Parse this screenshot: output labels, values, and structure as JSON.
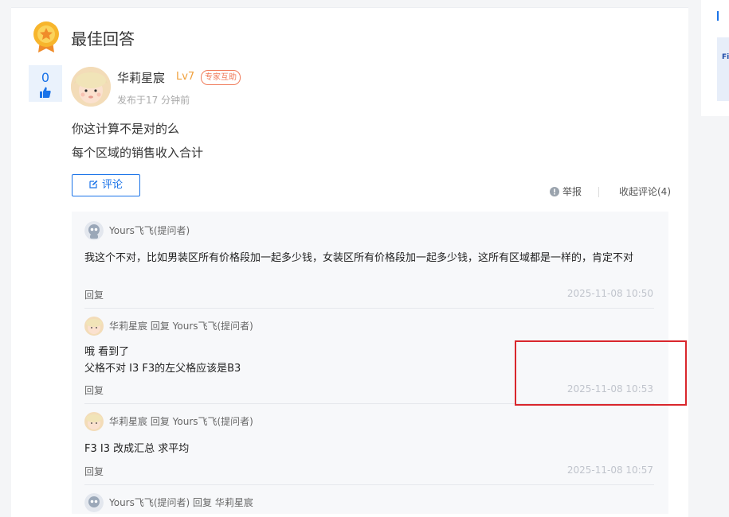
{
  "best_answer": {
    "title": "最佳回答",
    "vote_count": "0"
  },
  "author": {
    "name": "华莉星宸",
    "level": "Lv7",
    "tag": "专家互助",
    "posted": "发布于17 分钟前"
  },
  "answer_lines": [
    "你这计算不是对的么",
    "每个区域的销售收入合计"
  ],
  "actions": {
    "comment": "评论",
    "report": "举报",
    "collapse": "收起评论(4)"
  },
  "comments": [
    {
      "header": "Yours飞飞(提问者)",
      "lines": [
        "我这个不对，比如男装区所有价格段加一起多少钱，女装区所有价格段加一起多少钱，这所有区域都是一样的，肯定不对"
      ],
      "reply": "回复",
      "time": "2025-11-08 10:50"
    },
    {
      "header": "华莉星宸 回复 Yours飞飞(提问者)",
      "lines": [
        "哦 看到了",
        "父格不对 I3 F3的左父格应该是B3"
      ],
      "reply": "回复",
      "time": "2025-11-08 10:53"
    },
    {
      "header": "华莉星宸 回复 Yours飞飞(提问者)",
      "lines": [
        "F3 I3 改成汇总 求平均"
      ],
      "reply": "回复",
      "time": "2025-11-08 10:57"
    },
    {
      "header": "Yours飞飞(提问者) 回复 华莉星宸"
    }
  ],
  "sidebar": {
    "ad_text": "Fi"
  },
  "colors": {
    "accent": "#1a73e8",
    "level": "#f0a03c",
    "expert_tag": "#f07b5a",
    "highlight": "#d9262c"
  }
}
